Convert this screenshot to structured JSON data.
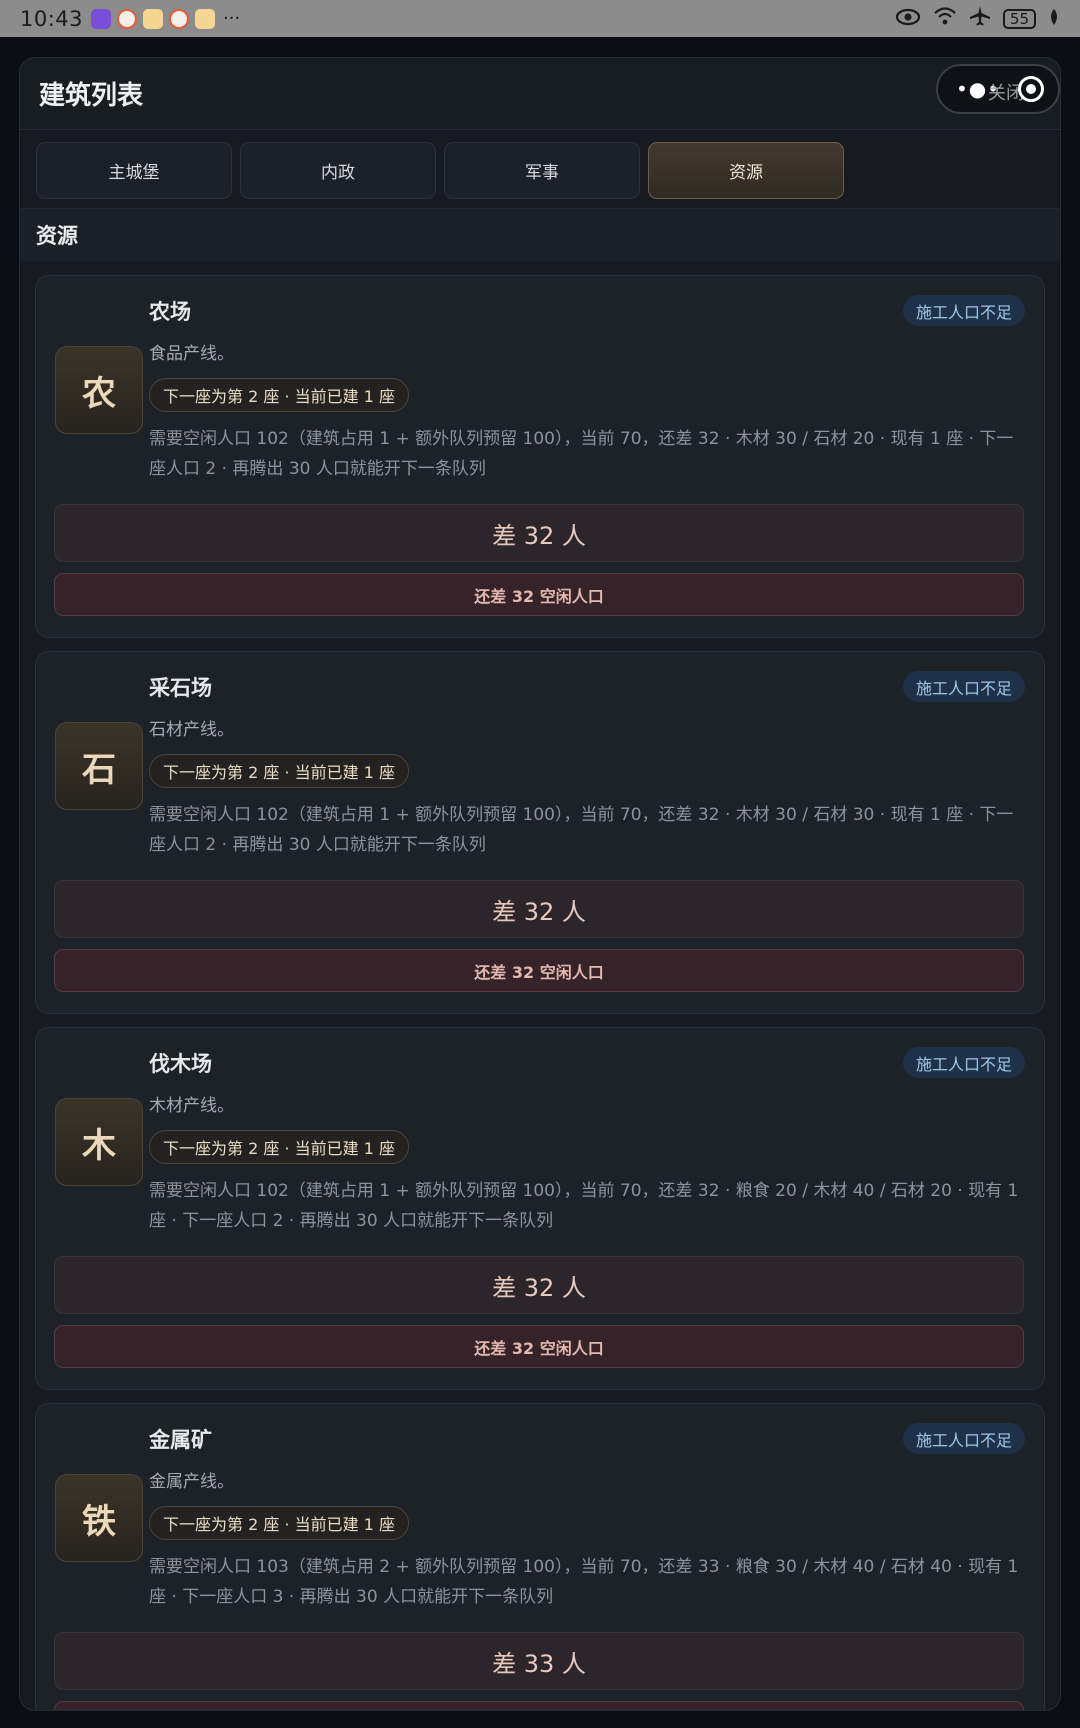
{
  "status_bar": {
    "time": "10:43",
    "more": "···",
    "battery": "55"
  },
  "header": {
    "title": "建筑列表",
    "close_label": "关闭"
  },
  "tabs": [
    {
      "label": "主城堡",
      "active": false
    },
    {
      "label": "内政",
      "active": false
    },
    {
      "label": "军事",
      "active": false
    },
    {
      "label": "资源",
      "active": true
    }
  ],
  "section_title": "资源",
  "cards": [
    {
      "icon_char": "农",
      "name": "农场",
      "status": "施工人口不足",
      "desc": "食品产线。",
      "pill": "下一座为第 2 座 · 当前已建 1 座",
      "detail": "需要空闲人口 102（建筑占用 1 + 额外队列预留 100），当前 70，还差 32 · 木材 30 / 石材 20 · 现有 1 座 · 下一座人口 2 · 再腾出 30 人口就能开下一条队列",
      "action": "差 32 人",
      "warn": "还差 32 空闲人口"
    },
    {
      "icon_char": "石",
      "name": "采石场",
      "status": "施工人口不足",
      "desc": "石材产线。",
      "pill": "下一座为第 2 座 · 当前已建 1 座",
      "detail": "需要空闲人口 102（建筑占用 1 + 额外队列预留 100），当前 70，还差 32 · 木材 30 / 石材 30 · 现有 1 座 · 下一座人口 2 · 再腾出 30 人口就能开下一条队列",
      "action": "差 32 人",
      "warn": "还差 32 空闲人口"
    },
    {
      "icon_char": "木",
      "name": "伐木场",
      "status": "施工人口不足",
      "desc": "木材产线。",
      "pill": "下一座为第 2 座 · 当前已建 1 座",
      "detail": "需要空闲人口 102（建筑占用 1 + 额外队列预留 100），当前 70，还差 32 · 粮食 20 / 木材 40 / 石材 20 · 现有 1 座 · 下一座人口 2 · 再腾出 30 人口就能开下一条队列",
      "action": "差 32 人",
      "warn": "还差 32 空闲人口"
    },
    {
      "icon_char": "铁",
      "name": "金属矿",
      "status": "施工人口不足",
      "desc": "金属产线。",
      "pill": "下一座为第 2 座 · 当前已建 1 座",
      "detail": "需要空闲人口 103（建筑占用 2 + 额外队列预留 100），当前 70，还差 33 · 粮食 30 / 木材 40 / 石材 40 · 现有 1 座 · 下一座人口 3 · 再腾出 30 人口就能开下一条队列",
      "action": "差 33 人",
      "warn": ""
    }
  ]
}
